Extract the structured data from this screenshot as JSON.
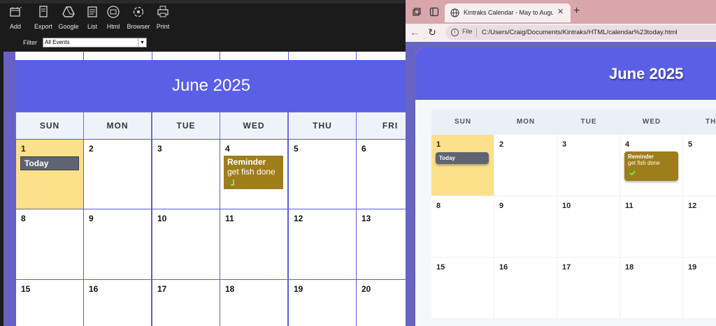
{
  "left_app": {
    "toolbar": [
      {
        "label": "Add",
        "icon": "calendar-add-icon"
      },
      {
        "label": "Export",
        "icon": "export-icon"
      },
      {
        "label": "Google",
        "icon": "google-drive-icon"
      },
      {
        "label": "List",
        "icon": "list-icon"
      },
      {
        "label": "Html",
        "icon": "html-icon"
      },
      {
        "label": "Browser",
        "icon": "browser-icon"
      },
      {
        "label": "Print",
        "icon": "print-icon"
      }
    ],
    "filter": {
      "label": "Filter",
      "value": "All Events"
    },
    "calendar": {
      "month_title": "June 2025",
      "weekdays": [
        "SUN",
        "MON",
        "TUE",
        "WED",
        "THU",
        "FRI"
      ],
      "rows": [
        [
          "1",
          "2",
          "3",
          "4",
          "5",
          "6"
        ],
        [
          "8",
          "9",
          "10",
          "11",
          "12",
          "13"
        ],
        [
          "15",
          "16",
          "17",
          "18",
          "19",
          "20"
        ]
      ],
      "today_badge": "Today",
      "event": {
        "title": "Reminder",
        "detail": "get fish done"
      }
    }
  },
  "browser": {
    "tab_title": "Kintraks Calendar - May to August",
    "address": {
      "scheme_label": "File",
      "url": "C:/Users/Craig/Documents/Kintraks/HTML/calendar%23today.html"
    },
    "calendar": {
      "month_title": "June 2025",
      "weekdays": [
        "SUN",
        "MON",
        "TUE",
        "WED",
        "TH"
      ],
      "rows": [
        [
          "1",
          "2",
          "3",
          "4",
          "5"
        ],
        [
          "8",
          "9",
          "10",
          "11",
          "12"
        ],
        [
          "15",
          "16",
          "17",
          "18",
          "19"
        ]
      ],
      "today_badge": "Today",
      "event": {
        "title": "Reminder",
        "detail": "get fish done"
      }
    }
  },
  "colors": {
    "banner": "#5a5fe6",
    "today_bg": "#fde08a",
    "event_bg": "#9e7d1b",
    "badge_bg": "#5f6471",
    "grid_border": "#5b5bd6"
  }
}
